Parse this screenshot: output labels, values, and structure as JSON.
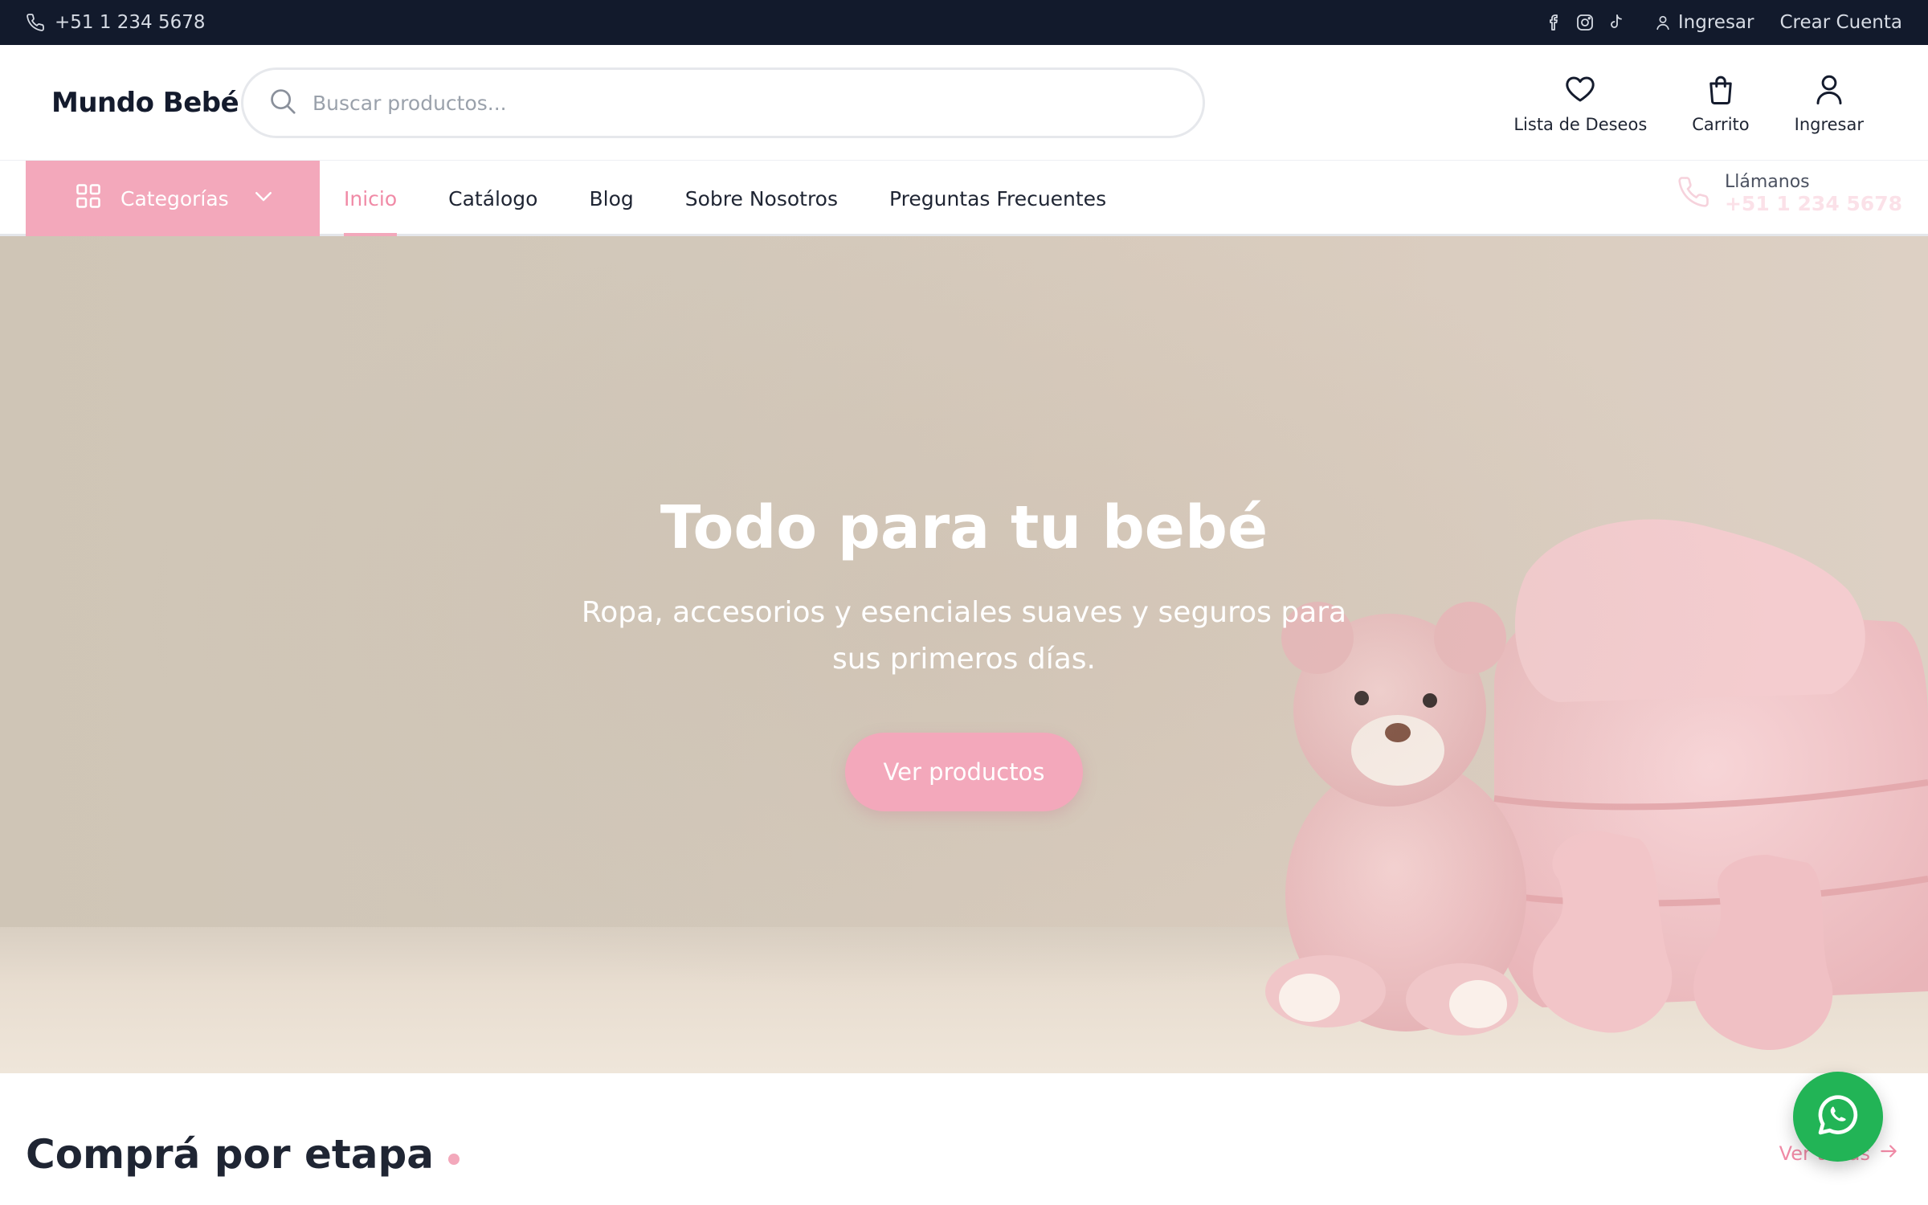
{
  "topbar": {
    "phone": "+51 1 234 5678",
    "social_icons": [
      "facebook-icon",
      "instagram-icon",
      "tiktok-icon"
    ],
    "login": "Ingresar",
    "create_account": "Crear Cuenta"
  },
  "header": {
    "logo": "Mundo Bebé",
    "search_placeholder": "Buscar productos...",
    "actions": {
      "wishlist": "Lista de Deseos",
      "cart": "Carrito",
      "login": "Ingresar"
    }
  },
  "nav": {
    "categories": "Categorías",
    "links": {
      "home": "Inicio",
      "catalog": "Catálogo",
      "blog": "Blog",
      "about": "Sobre Nosotros",
      "faq": "Preguntas Frecuentes"
    },
    "call_label": "Llámanos",
    "call_number": "+51 1 234 5678"
  },
  "hero": {
    "title": "Todo para tu bebé",
    "subtitle": "Ropa, accesorios y esenciales suaves y seguros para sus primeros días.",
    "button": "Ver productos"
  },
  "section": {
    "title": "Comprá por etapa",
    "see_all": "Ver todas"
  },
  "colors": {
    "topbar": "#121a2c",
    "accent_pink": "#f3a8bb",
    "active_link": "#f08aa6",
    "whatsapp": "#22b456"
  }
}
